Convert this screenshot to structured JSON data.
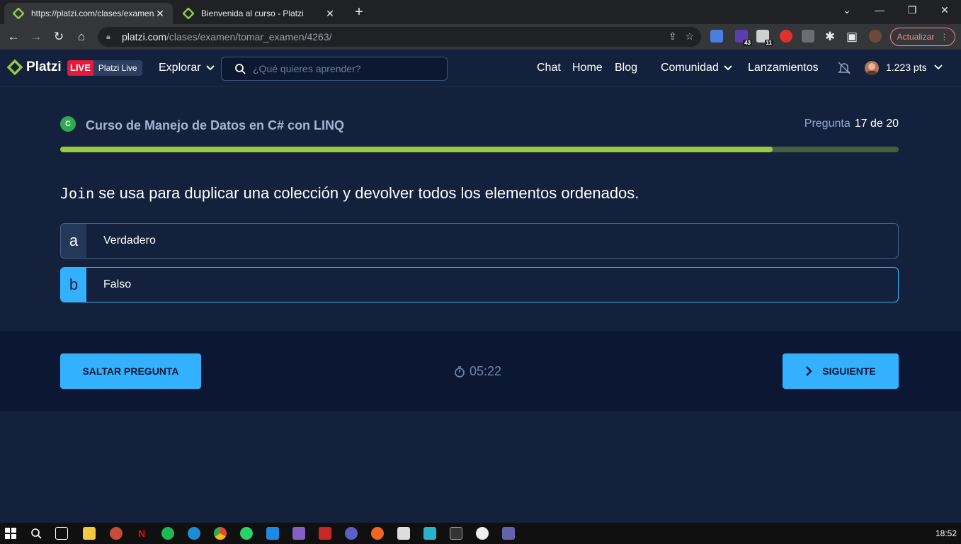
{
  "browser": {
    "tabs": [
      {
        "title": "https://platzi.com/clases/examen/",
        "active": true
      },
      {
        "title": "Bienvenida al curso - Platzi",
        "active": false
      }
    ],
    "new_tab_icon": "plus-icon",
    "url_host": "platzi.com",
    "url_path": "/clases/examen/tomar_examen/4263/",
    "extension_badges": [
      "43",
      "11"
    ],
    "update_label": "Actualizar"
  },
  "header": {
    "logo_text": "Platzi",
    "live_label": "LIVE",
    "live_name": "Platzi Live",
    "explore_label": "Explorar",
    "search_placeholder": "¿Qué quieres aprender?",
    "nav": [
      "Chat",
      "Home",
      "Blog"
    ],
    "community_label": "Comunidad",
    "launches_label": "Lanzamientos",
    "points": "1.223 pts"
  },
  "quiz": {
    "course_icon_letter": "C",
    "course_title": "Curso de Manejo de Datos en C# con LINQ",
    "question_label": "Pregunta",
    "question_counter": "17 de 20",
    "progress_fraction": 0.85,
    "question_code": "Join",
    "question_text": " se usa para duplicar una colección y devolver todos los elementos ordenados.",
    "options": [
      {
        "letter": "a",
        "text": "Verdadero",
        "selected": false
      },
      {
        "letter": "b",
        "text": "Falso",
        "selected": true
      }
    ]
  },
  "footer": {
    "skip_label": "SALTAR PREGUNTA",
    "timer": "05:22",
    "next_label": "SIGUIENTE"
  },
  "taskbar": {
    "clock": "18:52"
  },
  "colors": {
    "accent": "#33b1ff",
    "progress": "#98ca3f",
    "background": "#13213d",
    "footer": "#0b1733",
    "live_red": "#e21b3c"
  }
}
